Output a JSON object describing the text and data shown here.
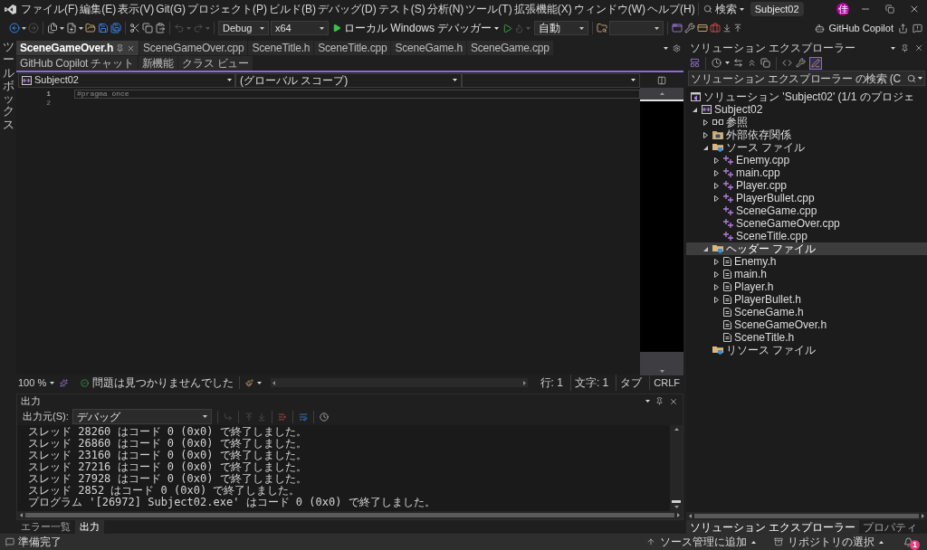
{
  "menu_bar": {
    "items": [
      "ファイル(F)",
      "編集(E)",
      "表示(V)",
      "Git(G)",
      "プロジェクト(P)",
      "ビルド(B)",
      "デバッグ(D)",
      "テスト(S)",
      "分析(N)",
      "ツール(T)",
      "拡張機能(X)",
      "ウィンドウ(W)",
      "ヘルプ(H)"
    ],
    "search": "検索",
    "solution_name": "Subject02",
    "avatar": "佳"
  },
  "toolbar": {
    "configuration": "Debug",
    "platform": "x64",
    "start_debugging": "ローカル Windows デバッガー",
    "mode": "自動",
    "copilot": "GitHub Copilot"
  },
  "toolbox": {
    "label": "ツールボックス"
  },
  "document_tabs": [
    {
      "label": "SceneGameOver.h",
      "selected": true
    },
    {
      "label": "SceneGameOver.cpp",
      "selected": false
    },
    {
      "label": "SceneTitle.h",
      "selected": false
    },
    {
      "label": "SceneTitle.cpp",
      "selected": false
    },
    {
      "label": "SceneGame.h",
      "selected": false
    },
    {
      "label": "SceneGame.cpp",
      "selected": false
    },
    {
      "label": "GitHub Copilot チャット",
      "selected": false
    },
    {
      "label": "新機能",
      "selected": false
    },
    {
      "label": "クラス ビュー",
      "selected": false
    }
  ],
  "navigation_bar": {
    "project": "Subject02",
    "scope": "(グローバル スコープ)"
  },
  "editor": {
    "lines": [
      {
        "number": "1",
        "code": "#pragma once",
        "current": true
      },
      {
        "number": "2",
        "current": false
      }
    ]
  },
  "editor_status": {
    "zoom": "100 %",
    "issues": "問題は見つかりませんでした",
    "line": "行: 1",
    "column": "文字: 1",
    "indent": "タブ",
    "line_ending": "CRLF"
  },
  "output": {
    "title": "出力",
    "source_label": "出力元(S):",
    "source": "デバッグ",
    "lines": [
      "スレッド 28260 はコード 0 (0x0) で終了しました。",
      "スレッド 26860 はコード 0 (0x0) で終了しました。",
      "スレッド 23160 はコード 0 (0x0) で終了しました。",
      "スレッド 27216 はコード 0 (0x0) で終了しました。",
      "スレッド 27928 はコード 0 (0x0) で終了しました。",
      "スレッド 2852 はコード 0 (0x0) で終了しました。",
      "プログラム '[26972] Subject02.exe' はコード 0 (0x0) で終了しました。"
    ]
  },
  "bottom_tabs": [
    {
      "label": "エラー一覧",
      "selected": false
    },
    {
      "label": "出力",
      "selected": true
    }
  ],
  "solution_explorer": {
    "title": "ソリューション エクスプローラー",
    "toolbar_toggle": {
      "on": true
    },
    "search": {
      "placeholder": "ソリューション エクスプローラー の検索 (C"
    },
    "tree": [
      {
        "kind": "solution",
        "label": "ソリューション 'Subject02' (1/1 のプロジェ",
        "selected": false
      },
      {
        "kind": "project",
        "label": "Subject02",
        "expanded": true,
        "selected": false,
        "children": [
          {
            "kind": "references",
            "label": "参照",
            "expanded": false,
            "selected": false
          },
          {
            "kind": "external",
            "label": "外部依存関係",
            "expanded": false,
            "selected": false
          },
          {
            "kind": "folder",
            "label": "ソース ファイル",
            "expanded": true,
            "selected": false,
            "children": [
              {
                "kind": "cpp",
                "label": "Enemy.cpp",
                "expanded": false,
                "selected": false
              },
              {
                "kind": "cpp",
                "label": "main.cpp",
                "expanded": false,
                "selected": false
              },
              {
                "kind": "cpp",
                "label": "Player.cpp",
                "expanded": false,
                "selected": false
              },
              {
                "kind": "cpp",
                "label": "PlayerBullet.cpp",
                "expanded": false,
                "selected": false
              },
              {
                "kind": "cpp",
                "label": "SceneGame.cpp",
                "selected": false
              },
              {
                "kind": "cpp",
                "label": "SceneGameOver.cpp",
                "selected": false
              },
              {
                "kind": "cpp",
                "label": "SceneTitle.cpp",
                "selected": false
              }
            ]
          },
          {
            "kind": "folder",
            "label": "ヘッダー ファイル",
            "expanded": true,
            "selected": true,
            "children": [
              {
                "kind": "header",
                "label": "Enemy.h",
                "expanded": false,
                "selected": false
              },
              {
                "kind": "header",
                "label": "main.h",
                "expanded": false,
                "selected": false
              },
              {
                "kind": "header",
                "label": "Player.h",
                "expanded": false,
                "selected": false
              },
              {
                "kind": "header",
                "label": "PlayerBullet.h",
                "expanded": false,
                "selected": false
              },
              {
                "kind": "header",
                "label": "SceneGame.h",
                "selected": false
              },
              {
                "kind": "header",
                "label": "SceneGameOver.h",
                "selected": false
              },
              {
                "kind": "header",
                "label": "SceneTitle.h",
                "selected": false
              }
            ]
          },
          {
            "kind": "folder",
            "label": "リソース ファイル",
            "selected": false
          }
        ]
      }
    ],
    "tabs": [
      {
        "label": "ソリューション エクスプローラー",
        "selected": true
      },
      {
        "label": "プロパティ",
        "selected": false
      }
    ]
  },
  "status_bar": {
    "message": "準備完了",
    "source_control": "ソース管理に追加",
    "repository": "リポジトリの選択",
    "notification_count": "1"
  }
}
